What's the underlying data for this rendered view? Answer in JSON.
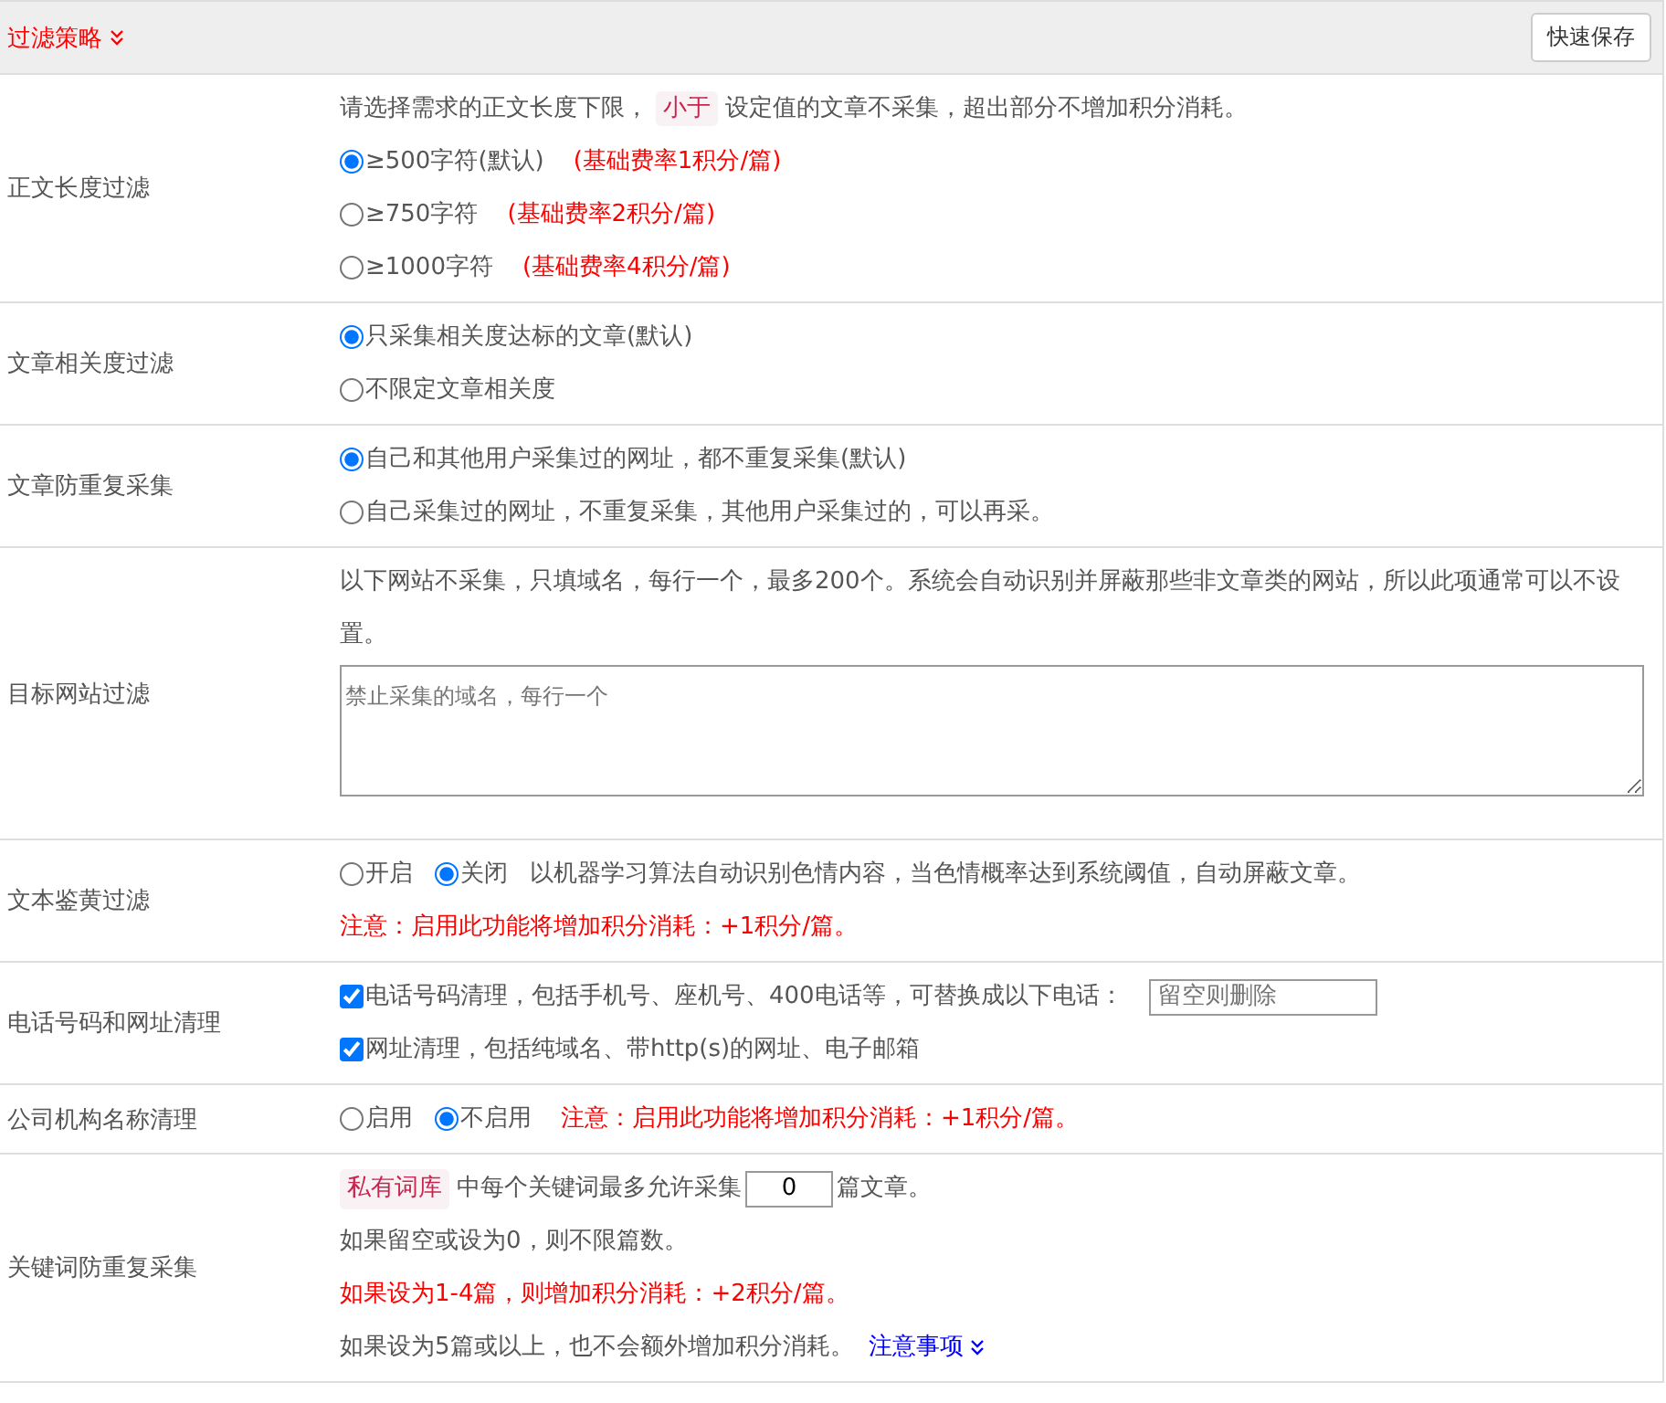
{
  "header": {
    "title": "过滤策略",
    "save_button": "快速保存"
  },
  "rows": [
    {
      "label": "正文长度过滤",
      "lines": [
        [
          {
            "kind": "text",
            "text": "请选择需求的正文长度下限，"
          },
          {
            "kind": "tag",
            "text": "小于"
          },
          {
            "kind": "text",
            "text": "设定值的文章不采集，超出部分不增加积分消耗。"
          }
        ],
        [
          {
            "kind": "radio",
            "label": "≥500字符(默认)",
            "selected": true
          },
          {
            "kind": "note",
            "text": "(基础费率1积分/篇)"
          }
        ],
        [
          {
            "kind": "radio",
            "label": "≥750字符",
            "selected": false
          },
          {
            "kind": "note",
            "text": "(基础费率2积分/篇)"
          }
        ],
        [
          {
            "kind": "radio",
            "label": "≥1000字符",
            "selected": false
          },
          {
            "kind": "note",
            "text": "(基础费率4积分/篇)"
          }
        ]
      ]
    },
    {
      "label": "文章相关度过滤",
      "lines": [
        [
          {
            "kind": "radio",
            "label": "只采集相关度达标的文章(默认)",
            "selected": true
          }
        ],
        [
          {
            "kind": "radio",
            "label": "不限定文章相关度",
            "selected": false
          }
        ]
      ]
    },
    {
      "label": "文章防重复采集",
      "lines": [
        [
          {
            "kind": "radio",
            "label": "自己和其他用户采集过的网址，都不重复采集(默认)",
            "selected": true
          }
        ],
        [
          {
            "kind": "radio",
            "label": "自己采集过的网址，不重复采集，其他用户采集过的，可以再采。",
            "selected": false
          }
        ]
      ]
    },
    {
      "label": "目标网站过滤",
      "lines": [
        [
          {
            "kind": "text",
            "text": "以下网站不采集，只填域名，每行一个，最多200个。系统会自动识别并屏蔽那些非文章类的网站，所以此项通常可以不设置。"
          }
        ],
        [
          {
            "kind": "textarea",
            "placeholder": "禁止采集的域名，每行一个"
          }
        ]
      ]
    },
    {
      "label": "文本鉴黄过滤",
      "lines": [
        [
          {
            "kind": "radio",
            "label": "开启",
            "selected": false
          },
          {
            "kind": "radio",
            "label": "关闭",
            "selected": true
          },
          {
            "kind": "text",
            "text": "以机器学习算法自动识别色情内容，当色情概率达到系统阈值，自动屏蔽文章。"
          }
        ],
        [
          {
            "kind": "note",
            "text": "注意：启用此功能将增加积分消耗：+1积分/篇。"
          }
        ]
      ]
    },
    {
      "label": "电话号码和网址清理",
      "lines": [
        [
          {
            "kind": "checkbox",
            "label": "电话号码清理，包括手机号、座机号、400电话等，可替换成以下电话：",
            "checked": true
          },
          {
            "kind": "input",
            "placeholder": "留空则删除"
          }
        ],
        [
          {
            "kind": "checkbox",
            "label": "网址清理，包括纯域名、带http(s)的网址、电子邮箱",
            "checked": true
          }
        ]
      ]
    },
    {
      "label": "公司机构名称清理",
      "lines": [
        [
          {
            "kind": "radio",
            "label": "启用",
            "selected": false
          },
          {
            "kind": "radio",
            "label": "不启用",
            "selected": true
          },
          {
            "kind": "note",
            "text": "注意：启用此功能将增加积分消耗：+1积分/篇。"
          }
        ]
      ]
    },
    {
      "label": "关键词防重复采集",
      "lines": [
        [
          {
            "kind": "tag",
            "text": "私有词库"
          },
          {
            "kind": "text",
            "text": "中每个关键词最多允许采集"
          },
          {
            "kind": "input",
            "value": "0"
          },
          {
            "kind": "text",
            "text": "篇文章。"
          }
        ],
        [
          {
            "kind": "text",
            "text": "如果留空或设为0，则不限篇数。"
          }
        ],
        [
          {
            "kind": "note",
            "text": "如果设为1-4篇，则增加积分消耗：+2积分/篇。"
          }
        ],
        [
          {
            "kind": "text",
            "text": "如果设为5篇或以上，也不会额外增加积分消耗。"
          },
          {
            "kind": "link",
            "text": "注意事项"
          }
        ]
      ]
    }
  ]
}
